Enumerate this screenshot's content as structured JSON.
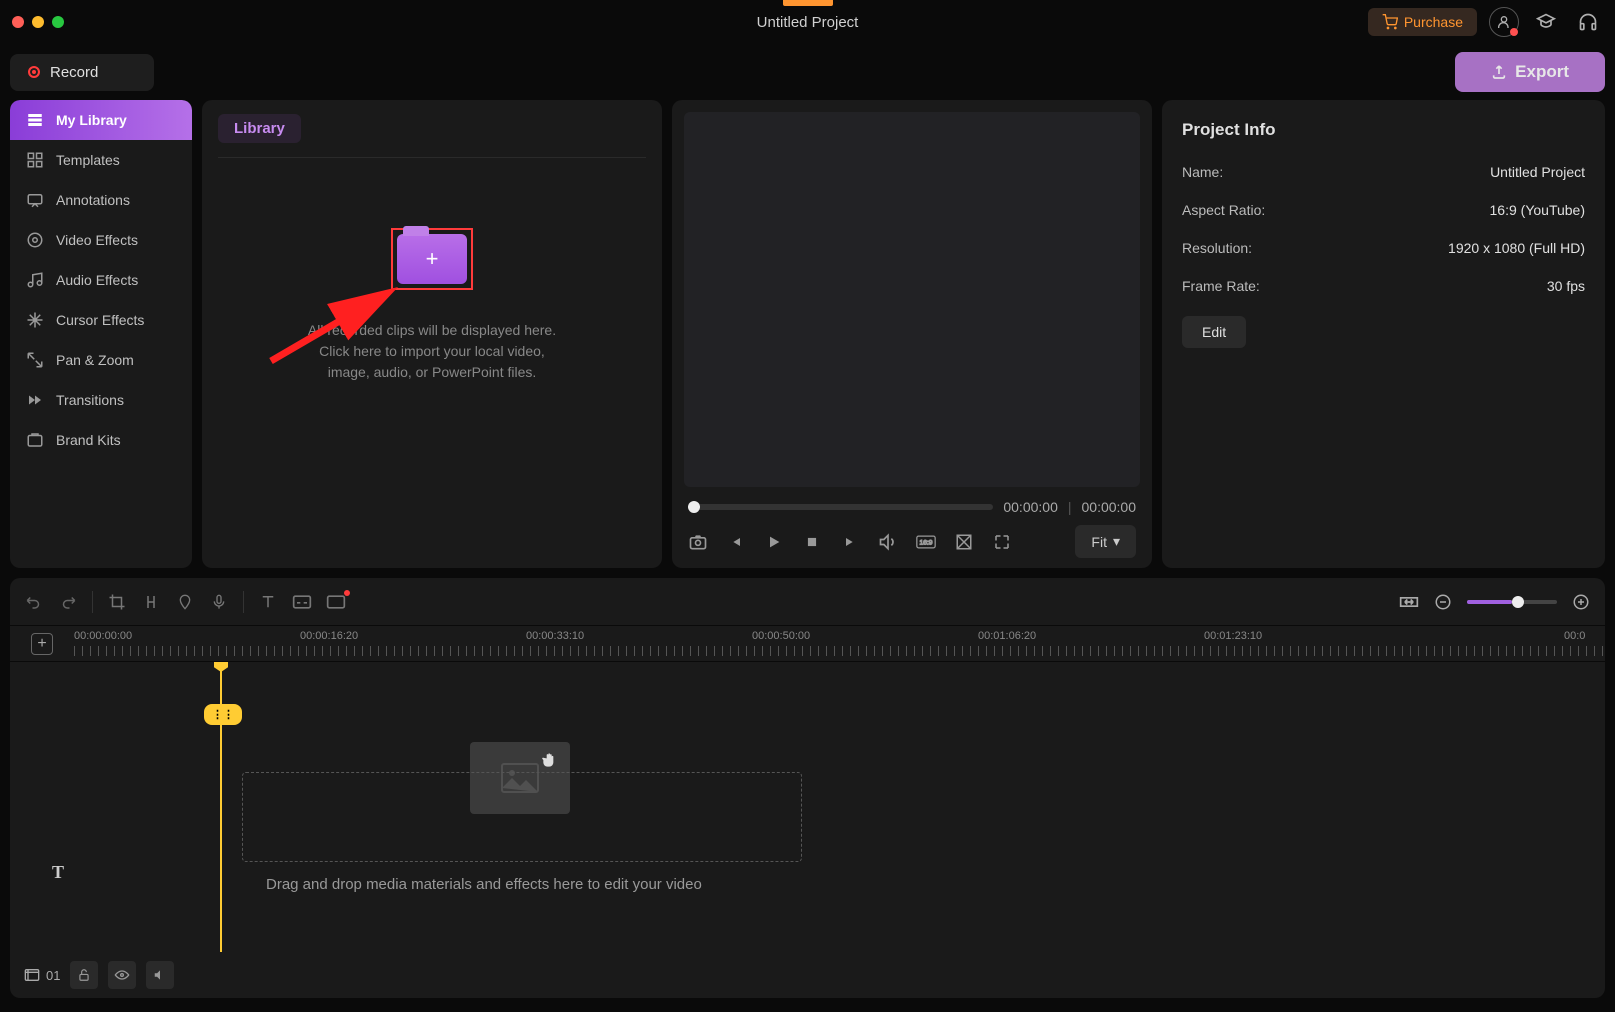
{
  "titlebar": {
    "title": "Untitled Project",
    "purchase": "Purchase"
  },
  "topbar": {
    "record": "Record",
    "export": "Export"
  },
  "sidebar": {
    "items": [
      {
        "label": "My Library"
      },
      {
        "label": "Templates"
      },
      {
        "label": "Annotations"
      },
      {
        "label": "Video Effects"
      },
      {
        "label": "Audio Effects"
      },
      {
        "label": "Cursor Effects"
      },
      {
        "label": "Pan & Zoom"
      },
      {
        "label": "Transitions"
      },
      {
        "label": "Brand Kits"
      }
    ]
  },
  "library": {
    "tab": "Library",
    "hint": "All recorded clips will be displayed here.\nClick here to import your local video,\nimage, audio, or PowerPoint files."
  },
  "preview": {
    "current": "00:00:00",
    "total": "00:00:00",
    "fit": "Fit"
  },
  "info": {
    "title": "Project Info",
    "name_label": "Name:",
    "name": "Untitled Project",
    "aspect_label": "Aspect Ratio:",
    "aspect": "16:9 (YouTube)",
    "resolution_label": "Resolution:",
    "resolution": "1920 x 1080 (Full HD)",
    "framerate_label": "Frame Rate:",
    "framerate": "30 fps",
    "edit": "Edit"
  },
  "timeline": {
    "marks": [
      "00:00:00:00",
      "00:00:16:20",
      "00:00:33:10",
      "00:00:50:00",
      "00:01:06:20",
      "00:01:23:10",
      "00:0"
    ],
    "drop_hint": "Drag and drop media materials and effects here to edit your video",
    "track_num": "01"
  }
}
